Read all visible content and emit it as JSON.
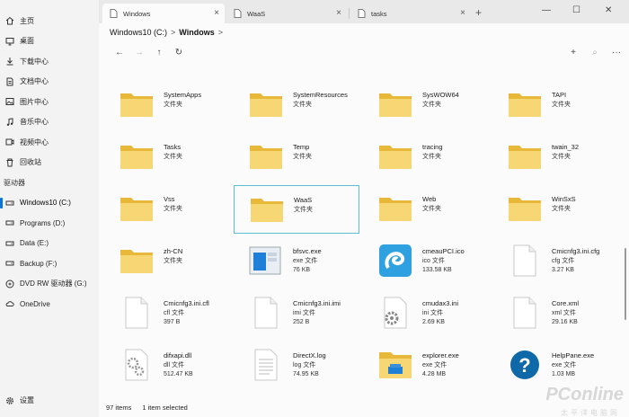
{
  "sidebar": {
    "items": [
      {
        "label": "主页",
        "icon": "home-icon"
      },
      {
        "label": "桌面",
        "icon": "desktop-icon"
      },
      {
        "label": "下载中心",
        "icon": "download-icon"
      },
      {
        "label": "文档中心",
        "icon": "document-icon"
      },
      {
        "label": "图片中心",
        "icon": "picture-icon"
      },
      {
        "label": "音乐中心",
        "icon": "music-icon"
      },
      {
        "label": "视频中心",
        "icon": "video-icon"
      },
      {
        "label": "回收站",
        "icon": "recycle-bin-icon"
      }
    ],
    "section_label": "驱动器",
    "drives": [
      {
        "label": "Windows10 (C:)",
        "active": true
      },
      {
        "label": "Programs (D:)"
      },
      {
        "label": "Data (E:)"
      },
      {
        "label": "Backup (F:)"
      },
      {
        "label": "DVD RW 驱动器 (G:)"
      },
      {
        "label": "OneDrive"
      }
    ],
    "settings_label": "设置"
  },
  "tabs": [
    {
      "label": "Windows",
      "active": true
    },
    {
      "label": "WaaS"
    },
    {
      "label": "tasks"
    }
  ],
  "window_controls": {
    "minimize": "—",
    "maximize": "☐",
    "close": "✕"
  },
  "breadcrumb": {
    "root": "Windows10 (C:)",
    "current": "Windows",
    "sep": ">"
  },
  "toolbar": {
    "back": "←",
    "forward": "→",
    "up": "↑",
    "refresh": "↻",
    "add": "+",
    "search": "⌕",
    "more": "···"
  },
  "items": [
    {
      "name": "SystemApps",
      "type": "文件夹",
      "kind": "folder"
    },
    {
      "name": "SystemResources",
      "type": "文件夹",
      "kind": "folder"
    },
    {
      "name": "SysWOW64",
      "type": "文件夹",
      "kind": "folder"
    },
    {
      "name": "TAPI",
      "type": "文件夹",
      "kind": "folder"
    },
    {
      "name": "Tasks",
      "type": "文件夹",
      "kind": "folder"
    },
    {
      "name": "Temp",
      "type": "文件夹",
      "kind": "folder"
    },
    {
      "name": "tracing",
      "type": "文件夹",
      "kind": "folder"
    },
    {
      "name": "twain_32",
      "type": "文件夹",
      "kind": "folder"
    },
    {
      "name": "Vss",
      "type": "文件夹",
      "kind": "folder"
    },
    {
      "name": "WaaS",
      "type": "文件夹",
      "kind": "folder",
      "selected": true
    },
    {
      "name": "Web",
      "type": "文件夹",
      "kind": "folder"
    },
    {
      "name": "WinSxS",
      "type": "文件夹",
      "kind": "folder"
    },
    {
      "name": "zh-CN",
      "type": "文件夹",
      "kind": "folder"
    },
    {
      "name": "bfsvc.exe",
      "type": "exe 文件",
      "size": "76 KB",
      "kind": "app-window"
    },
    {
      "name": "cmeauPCI.ico",
      "type": "ico 文件",
      "size": "133.58 KB",
      "kind": "swirl"
    },
    {
      "name": "Cmicnfg3.ini.cfg",
      "type": "cfg 文件",
      "size": "3.27 KB",
      "kind": "blank"
    },
    {
      "name": "Cmicnfg3.ini.cfl",
      "type": "cfl 文件",
      "size": "397 B",
      "kind": "blank"
    },
    {
      "name": "Cmicnfg3.ini.imi",
      "type": "imi 文件",
      "size": "252 B",
      "kind": "blank"
    },
    {
      "name": "cmudax3.ini",
      "type": "ini 文件",
      "size": "2.69 KB",
      "kind": "gear"
    },
    {
      "name": "Core.xml",
      "type": "xml 文件",
      "size": "29.16 KB",
      "kind": "blank"
    },
    {
      "name": "difxapi.dll",
      "type": "dll 文件",
      "size": "512.47 KB",
      "kind": "gears"
    },
    {
      "name": "DirectX.log",
      "type": "log 文件",
      "size": "74.95 KB",
      "kind": "text"
    },
    {
      "name": "explorer.exe",
      "type": "exe 文件",
      "size": "4.28 MB",
      "kind": "explorer"
    },
    {
      "name": "HelpPane.exe",
      "type": "exe 文件",
      "size": "1.03 MB",
      "kind": "help"
    }
  ],
  "status": {
    "count": "97 items",
    "selected": "1 item selected"
  },
  "watermark": {
    "brand": "PConline",
    "sub": "太平洋电脑网"
  },
  "colors": {
    "folder": "#f7d774",
    "folder_back": "#e8b83a",
    "accent": "#0a74d8",
    "selection": "#5bbfcf"
  }
}
